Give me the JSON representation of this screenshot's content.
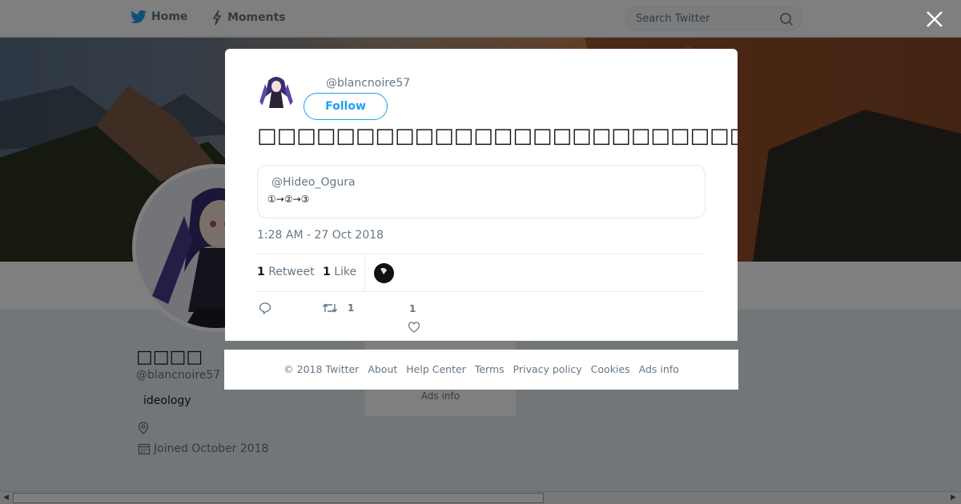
{
  "nav": {
    "home_label": "Home",
    "moments_label": "Moments",
    "search_placeholder": "Search Twitter"
  },
  "profile": {
    "display_name": "□□□□",
    "handle": "@blancnoire57",
    "bio": "ideology",
    "joined": "Joined October 2018",
    "side_ads_info": "Ads info"
  },
  "tweet": {
    "handle": "@blancnoire57",
    "follow_label": "Follow",
    "text": "□□□□□□□□□□□□□□□□□□□□□□□□□□□□□□□□□□□□□□□□□",
    "quote": {
      "handle": "@Hideo_Ogura",
      "text": "①→②→③"
    },
    "timestamp": "1:28 AM - 27 Oct 2018",
    "stats": {
      "retweet_count": "1",
      "retweet_label": "Retweet",
      "like_count": "1",
      "like_label": "Like"
    },
    "actions": {
      "retweet_count": "1",
      "like_count": "1"
    }
  },
  "footer": {
    "copyright": "© 2018 Twitter",
    "about": "About",
    "help": "Help Center",
    "terms": "Terms",
    "privacy": "Privacy policy",
    "cookies": "Cookies",
    "ads": "Ads info"
  },
  "colors": {
    "brand_blue": "#1da1f2",
    "muted_text": "#657786",
    "overlay": "rgba(0,0,0,0.5)"
  },
  "icons": [
    "twitter-bird-icon",
    "lightning-icon",
    "search-icon",
    "close-icon",
    "location-icon",
    "calendar-icon",
    "reply-icon",
    "retweet-icon",
    "heart-icon"
  ]
}
